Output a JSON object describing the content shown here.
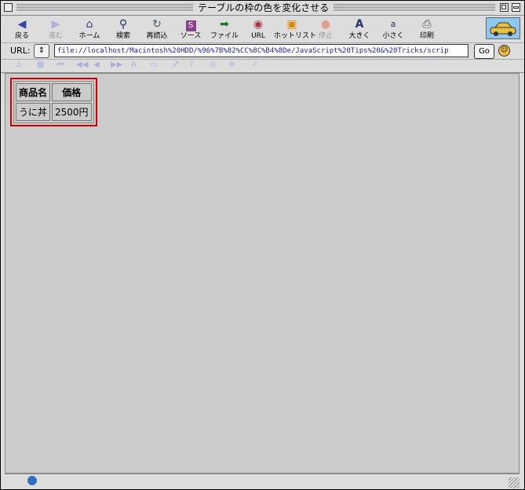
{
  "window": {
    "title": "テーブルの枠の色を変化させる"
  },
  "toolbar": {
    "items": [
      {
        "label": "戻る",
        "icon": "back-arrow-icon",
        "enabled": true
      },
      {
        "label": "進む",
        "icon": "forward-arrow-icon",
        "enabled": false
      },
      {
        "label": "ホーム",
        "icon": "home-icon",
        "enabled": true
      },
      {
        "label": "検索",
        "icon": "search-icon",
        "enabled": true
      },
      {
        "label": "再読込",
        "icon": "reload-icon",
        "enabled": true
      },
      {
        "label": "ソース",
        "icon": "source-icon",
        "enabled": true
      },
      {
        "label": "ファイル",
        "icon": "file-icon",
        "enabled": true
      },
      {
        "label": "URL",
        "icon": "url-icon",
        "enabled": true
      },
      {
        "label": "ホットリスト",
        "icon": "hotlist-icon",
        "enabled": true
      },
      {
        "label": "停止",
        "icon": "stop-icon",
        "enabled": false
      },
      {
        "label": "大きく",
        "icon": "larger-text-icon",
        "enabled": true
      },
      {
        "label": "小さく",
        "icon": "smaller-text-icon",
        "enabled": true
      },
      {
        "label": "印刷",
        "icon": "print-icon",
        "enabled": true
      }
    ]
  },
  "urlbar": {
    "label": "URL:",
    "value": "file://localhost/Macintosh%20HDD/%96%7B%82%CC%8C%B4%8De/JavaScript%20Tips%20&%20Tricks/scrip",
    "go_label": "Go"
  },
  "table": {
    "headers": [
      "商品名",
      "価格"
    ],
    "rows": [
      [
        "うに丼",
        "2500円"
      ]
    ],
    "border_color": "#cc0000"
  }
}
